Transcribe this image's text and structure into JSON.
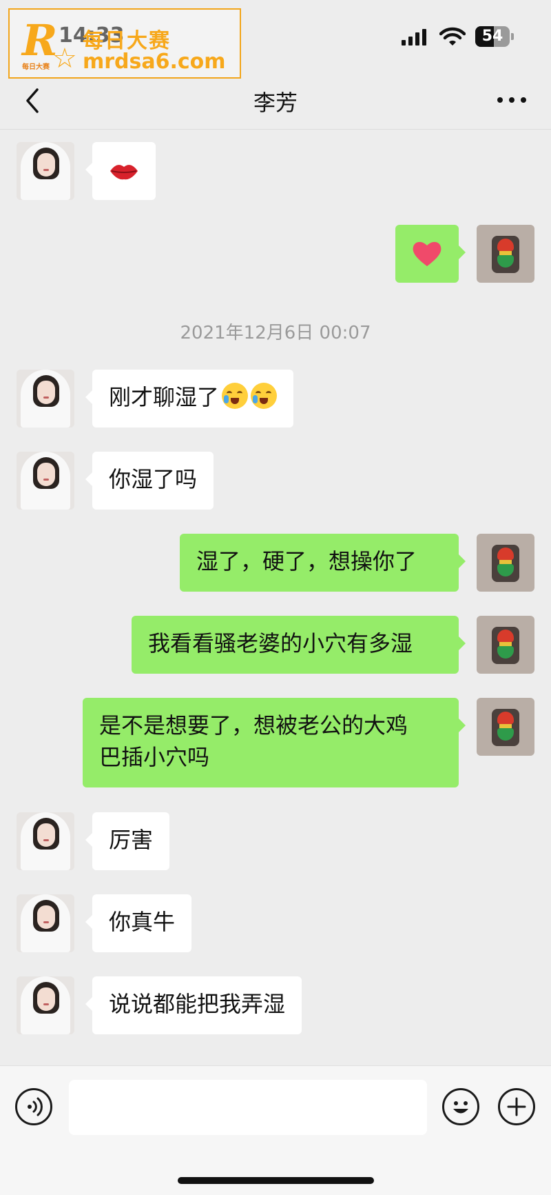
{
  "status_bar": {
    "time": "14:33",
    "battery": "54",
    "battery_level": 0.54
  },
  "watermark": {
    "letter": "R",
    "small_text": "每日大赛",
    "chinese": "每日大赛",
    "url": "mrdsa6.com"
  },
  "nav": {
    "title": "李芳"
  },
  "timestamp": "2021年12月6日 00:07",
  "messages": [
    {
      "side": "in",
      "text": "💋"
    },
    {
      "side": "out",
      "text": "❤️"
    },
    {
      "side": "in",
      "text": "刚才聊湿了",
      "emojis": [
        "loudly-crying-face",
        "loudly-crying-face"
      ]
    },
    {
      "side": "in",
      "text": "你湿了吗"
    },
    {
      "side": "out",
      "text": "湿了，硬了，想操你了"
    },
    {
      "side": "out",
      "text": "我看看骚老婆的小穴有多湿"
    },
    {
      "side": "out",
      "line1": "是不是想要了，想被老公的大鸡",
      "line2": "巴插小穴吗"
    },
    {
      "side": "in",
      "text": "厉害"
    },
    {
      "side": "in",
      "text": "你真牛"
    },
    {
      "side": "in",
      "text": "说说都能把我弄湿"
    }
  ],
  "colors": {
    "background": "#ededed",
    "incoming_bubble": "#ffffff",
    "outgoing_bubble": "#95ec69",
    "watermark": "#f7a81b"
  },
  "icons": {
    "back": "chevron-left-icon",
    "more": "more-dots-icon",
    "voice": "voice-icon",
    "emoji": "emoji-icon",
    "plus": "plus-icon"
  }
}
